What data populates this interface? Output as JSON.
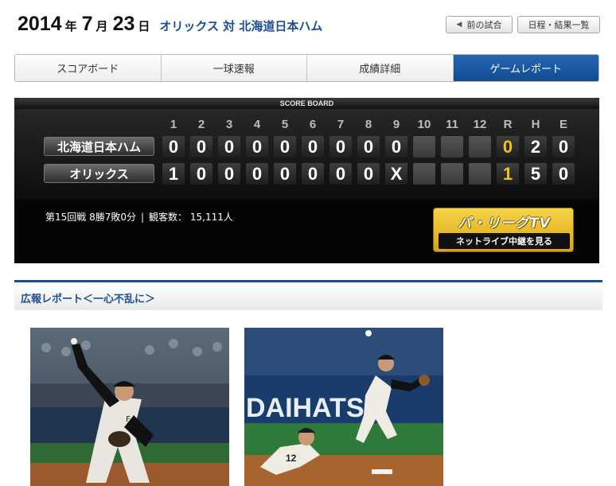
{
  "header": {
    "year": "2014",
    "year_unit": "年",
    "month": "7",
    "month_unit": "月",
    "day": "23",
    "day_unit": "日",
    "matchup": "オリックス 対 北海道日本ハム",
    "prev_game_label": "前の試合",
    "schedule_label": "日程・結果一覧"
  },
  "tabs": [
    {
      "label": "スコアボード",
      "active": false
    },
    {
      "label": "一球速報",
      "active": false
    },
    {
      "label": "成績詳細",
      "active": false
    },
    {
      "label": "ゲームレポート",
      "active": true
    }
  ],
  "scoreboard": {
    "caption": "SCORE BOARD",
    "headers": [
      "1",
      "2",
      "3",
      "4",
      "5",
      "6",
      "7",
      "8",
      "9",
      "10",
      "11",
      "12",
      "R",
      "H",
      "E"
    ],
    "teams": [
      {
        "name": "北海道日本ハム",
        "innings": [
          "0",
          "0",
          "0",
          "0",
          "0",
          "0",
          "0",
          "0",
          "0",
          "",
          "",
          ""
        ],
        "R": "0",
        "H": "2",
        "E": "0"
      },
      {
        "name": "オリックス",
        "innings": [
          "1",
          "0",
          "0",
          "0",
          "0",
          "0",
          "0",
          "0",
          "X",
          "",
          "",
          ""
        ],
        "R": "1",
        "H": "5",
        "E": "0"
      }
    ],
    "info": {
      "game_record": "第15回戦 8勝7敗0分",
      "separator": "|",
      "attendance_label": "観客数：",
      "attendance": "15,111人"
    }
  },
  "pacific_tv": {
    "logo_text": "パ・リーグTV",
    "button_label": "ネットライブ中継を見る"
  },
  "report": {
    "title": "広報レポート＜一心不乱に＞"
  },
  "colors": {
    "accent_blue": "#1a4f96",
    "active_tab": "#124b90",
    "runs_yellow": "#f0c419",
    "board_bg": "#050505"
  }
}
